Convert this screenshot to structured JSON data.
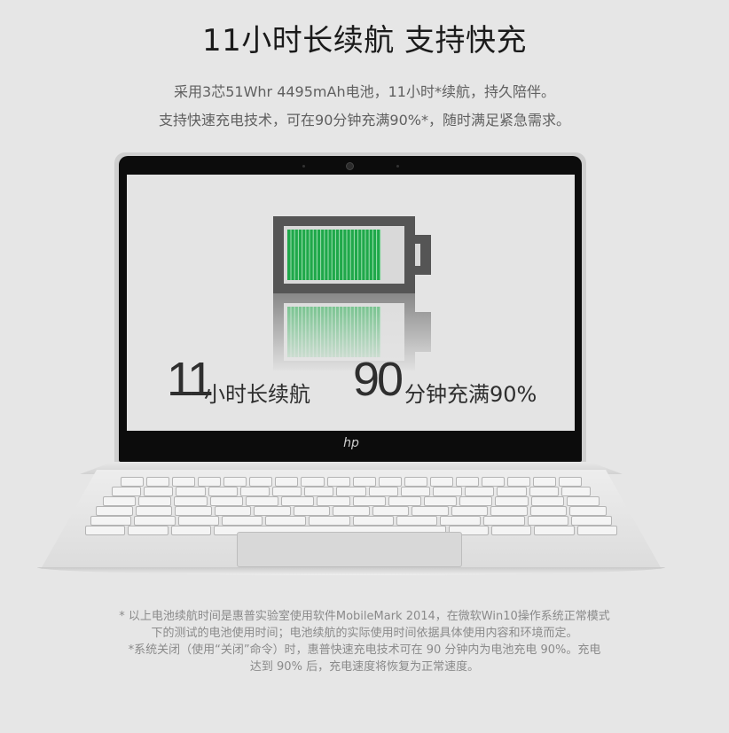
{
  "header": {
    "title": "11小时长续航 支持快充",
    "line1": "采用3芯51Whr 4495mAh电池，11小时*续航，持久陪伴。",
    "line2": "支持快速充电技术，可在90分钟充满90%*，随时满足紧急需求。"
  },
  "screen": {
    "battery_level": 0.82,
    "battery_color": "#1fa84a",
    "num1": "11",
    "txt1": "小时长续航",
    "num2": "90",
    "txt2": "分钟充满90%",
    "logo": "hp"
  },
  "footnotes": {
    "line1": "* 以上电池续航时间是惠普实验室使用软件MobileMark 2014，在微软Win10操作系统正常模式",
    "line2": "下的测试的电池使用时间；电池续航的实际使用时间依据具体使用内容和环境而定。",
    "line3": "*系统关闭（使用“关闭”命令）时，惠普快速充电技术可在 90 分钟内为电池充电 90%。充电",
    "line4": "达到 90% 后，充电速度将恢复为正常速度。"
  },
  "colors": {
    "background": "#e6e6e6",
    "battery_fill": "#1fa84a",
    "battery_frame": "#555555"
  }
}
